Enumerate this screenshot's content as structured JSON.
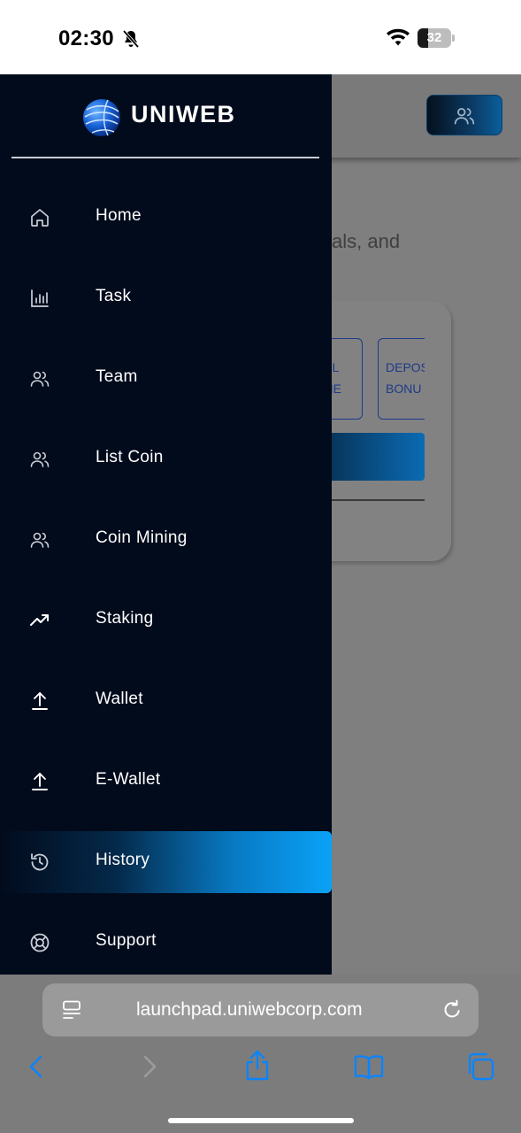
{
  "status_bar": {
    "time": "02:30",
    "battery_percent": "32",
    "battery_level": 0.32,
    "icons": [
      "bell-slash-icon",
      "wifi-icon",
      "battery-icon"
    ]
  },
  "background_page": {
    "visible_text": "als, and",
    "chips": [
      "VEL\nOME",
      "DEPOS\nBONU"
    ],
    "header_button_icon": "users-icon"
  },
  "drawer": {
    "brand_name": "UNIWEB",
    "logo_icon": "globe-logo-icon",
    "items": [
      {
        "label": "Home",
        "icon": "home-icon",
        "active": false
      },
      {
        "label": "Task",
        "icon": "bar-chart-icon",
        "active": false
      },
      {
        "label": "Team",
        "icon": "users-icon",
        "active": false
      },
      {
        "label": "List Coin",
        "icon": "users-icon",
        "active": false
      },
      {
        "label": "Coin Mining",
        "icon": "users-icon",
        "active": false
      },
      {
        "label": "Staking",
        "icon": "trending-up-icon",
        "active": false
      },
      {
        "label": "Wallet",
        "icon": "upload-icon",
        "active": false
      },
      {
        "label": "E-Wallet",
        "icon": "upload-icon",
        "active": false
      },
      {
        "label": "History",
        "icon": "history-icon",
        "active": true
      },
      {
        "label": "Support",
        "icon": "lifebuoy-icon",
        "active": false
      }
    ],
    "active_gradient": [
      "#020b1c",
      "#0aa2f7"
    ]
  },
  "safari": {
    "url": "launchpad.uniwebcorp.com",
    "toolbar_icons": [
      "back-icon",
      "forward-icon",
      "share-icon",
      "bookmarks-icon",
      "tabs-icon"
    ],
    "accent": "#0a84ff"
  },
  "colors": {
    "drawer_bg": "#020b1c",
    "overlay": "#7f7f7f"
  }
}
